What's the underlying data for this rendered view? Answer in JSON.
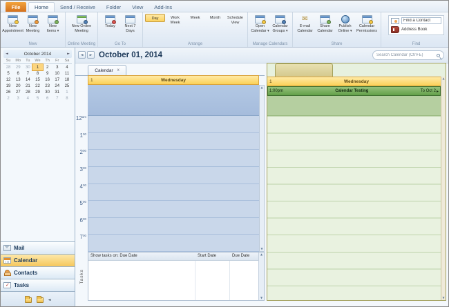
{
  "icons": {
    "left": "◄",
    "right": "►",
    "up": "▲",
    "down": "▼",
    "caret": "▾",
    "check": "✓",
    "envelope": "✉",
    "continue_arrow": "▸"
  },
  "chrome": {
    "file_tab": "File",
    "tabs": [
      "Home",
      "Send / Receive",
      "Folder",
      "View",
      "Add-Ins"
    ]
  },
  "ribbon": {
    "groups": [
      {
        "label": "New",
        "buttons": [
          {
            "l1": "New",
            "l2": "Appointment"
          },
          {
            "l1": "New",
            "l2": "Meeting"
          },
          {
            "l1": "New",
            "l2": "Items",
            "caret": "▾"
          }
        ]
      },
      {
        "label": "Online Meeting",
        "buttons": [
          {
            "l1": "New Online",
            "l2": "Meeting"
          }
        ]
      },
      {
        "label": "Go To",
        "buttons": [
          {
            "l1": "Today",
            "l2": ""
          },
          {
            "l1": "Next 7",
            "l2": "Days"
          }
        ]
      },
      {
        "label": "Arrange",
        "buttons": [
          {
            "l1": "Day",
            "l2": ""
          },
          {
            "l1": "Work",
            "l2": "Week"
          },
          {
            "l1": "Week",
            "l2": ""
          },
          {
            "l1": "Month",
            "l2": ""
          },
          {
            "l1": "Schedule",
            "l2": "View"
          }
        ]
      },
      {
        "label": "Manage Calendars",
        "buttons": [
          {
            "l1": "Open",
            "l2": "Calendar",
            "caret": "▾"
          },
          {
            "l1": "Calendar",
            "l2": "Groups",
            "caret": "▾"
          }
        ]
      },
      {
        "label": "Share",
        "buttons": [
          {
            "l1": "E-mail",
            "l2": "Calendar"
          },
          {
            "l1": "Share",
            "l2": "Calendar"
          },
          {
            "l1": "Publish",
            "l2": "Online",
            "caret": "▾"
          },
          {
            "l1": "Calendar",
            "l2": "Permissions"
          }
        ]
      },
      {
        "label": "Find",
        "find_contact_placeholder": "Find a Contact",
        "address_book": "Address Book"
      }
    ]
  },
  "sidebar": {
    "calendar": {
      "title": "October 2014",
      "dow": [
        "Su",
        "Mo",
        "Tu",
        "We",
        "Th",
        "Fr",
        "Sa"
      ],
      "weeks": [
        [
          "28",
          "29",
          "30",
          "1",
          "2",
          "3",
          "4"
        ],
        [
          "5",
          "6",
          "7",
          "8",
          "9",
          "10",
          "11"
        ],
        [
          "12",
          "13",
          "14",
          "15",
          "16",
          "17",
          "18"
        ],
        [
          "19",
          "20",
          "21",
          "22",
          "23",
          "24",
          "25"
        ],
        [
          "26",
          "27",
          "28",
          "29",
          "30",
          "31",
          "1"
        ],
        [
          "2",
          "3",
          "4",
          "5",
          "6",
          "7",
          "8"
        ]
      ],
      "selected_day": "1"
    },
    "nav": [
      "Mail",
      "Calendar",
      "Contacts",
      "Tasks"
    ],
    "selected_nav": "Calendar"
  },
  "main": {
    "title": "October 01, 2014",
    "search_placeholder": "Search Calendar (Ctrl+E)",
    "tab": "Calendar",
    "tab_close": "x",
    "day_num": "1",
    "day_name": "Wednesday",
    "times": [
      {
        "h": "12",
        "s": "am"
      },
      {
        "h": "1",
        "s": "00"
      },
      {
        "h": "2",
        "s": "00"
      },
      {
        "h": "3",
        "s": "00"
      },
      {
        "h": "4",
        "s": "00"
      },
      {
        "h": "5",
        "s": "00"
      },
      {
        "h": "6",
        "s": "00"
      },
      {
        "h": "7",
        "s": "00"
      }
    ],
    "tasks": {
      "side_label": "Tasks",
      "show_on": "Show tasks on: Due Date",
      "col_start": "Start Date",
      "col_due": "Due Date"
    }
  },
  "overlay": {
    "day_num": "1",
    "day_name": "Wednesday",
    "event": {
      "time": "1:00pm",
      "title": "Calendar Testing",
      "to": "To Oct 2"
    }
  },
  "colors": {
    "file_tab_orange": "#d4711c",
    "day_header_yellow": "#fbd158",
    "allday_blue": "#abc1de",
    "grid_blue": "#c9d7ea",
    "event_green": "#63a04a",
    "overlay_bg_green": "#e9f2e0",
    "nav_selected_orange": "#f5c75d"
  }
}
